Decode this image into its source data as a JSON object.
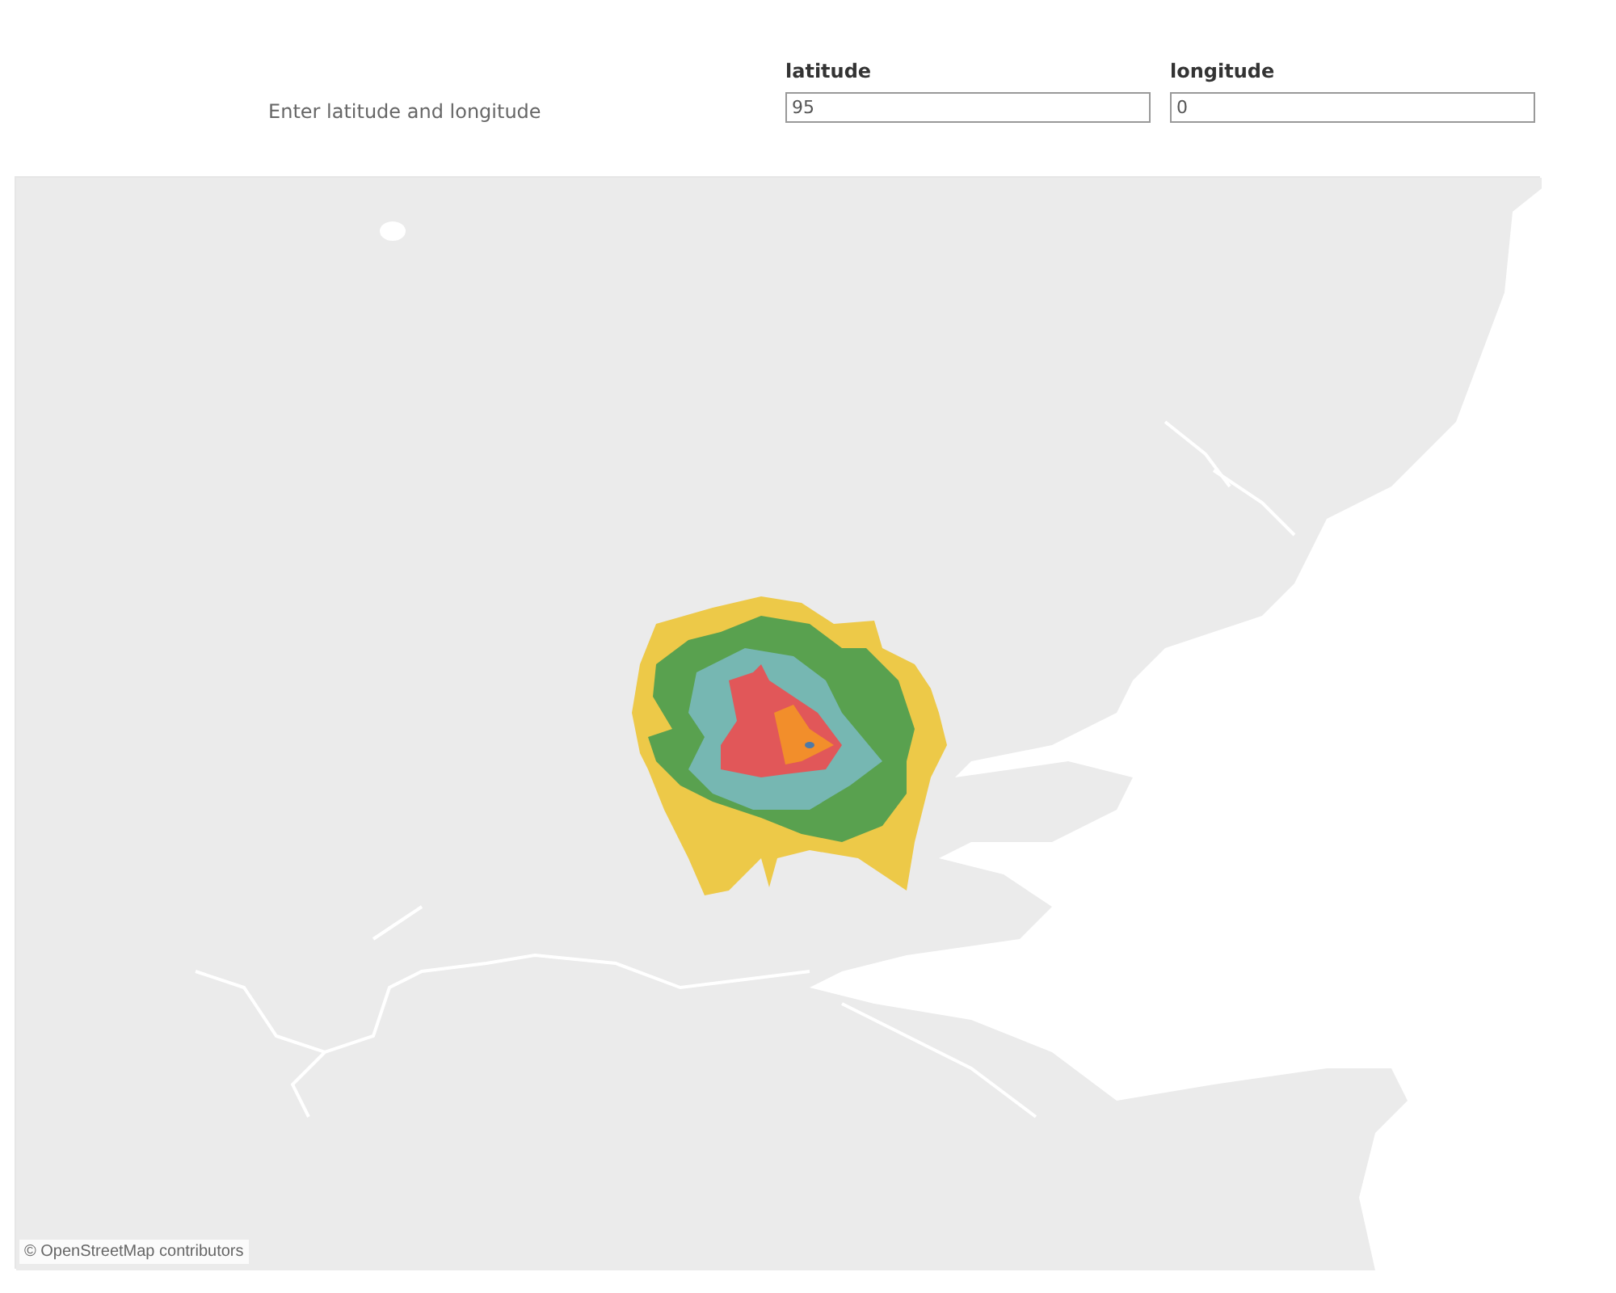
{
  "prompt": "Enter latitude and longitude",
  "fields": [
    {
      "label": "latitude",
      "value": "95"
    },
    {
      "label": "longitude",
      "value": "0"
    }
  ],
  "map": {
    "contours": [
      {
        "color": "#edc948"
      },
      {
        "color": "#59a14f"
      },
      {
        "color": "#76b7b2"
      },
      {
        "color": "#e15759"
      },
      {
        "color": "#f28e2b"
      },
      {
        "color": "#4e79a7"
      }
    ],
    "attribution": "© OpenStreetMap contributors"
  }
}
